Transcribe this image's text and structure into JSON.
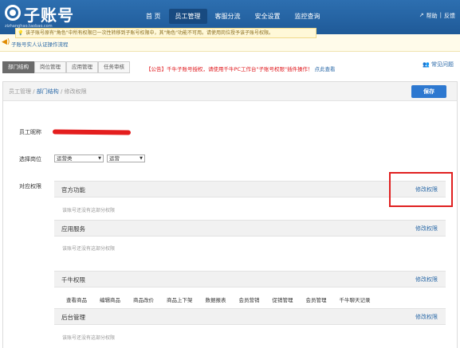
{
  "header": {
    "logo_text": "子账号",
    "logo_sub": "zizhanghao.taobao.com",
    "nav": [
      "首 页",
      "员工管理",
      "客服分流",
      "安全设置",
      "监控查询"
    ],
    "active_nav": "员工管理",
    "help": "帮助",
    "feedback": "反馈"
  },
  "notice": {
    "text": "子账号实人认证操作流程"
  },
  "tabs": [
    "部门结构",
    "岗位管理",
    "应用管理",
    "任务审核"
  ],
  "announcement": {
    "text": "【公告】千牛子账号授权，请使用千牛PC工作台\"子账号权限\"插件操作！",
    "link": "点此查看"
  },
  "faq": "常见问题",
  "breadcrumb": {
    "root": "员工管理",
    "mid": "部门结构",
    "current": "修改权限",
    "sep": " / "
  },
  "save_label": "保存",
  "tip": "该子账号原有\"角色\"中所有权限已一次性转移到子账号权限中，其\"角色\"功能不可用。请使用岗位授予该子账号权限。",
  "form": {
    "nickname_label": "员工昵称",
    "position_label": "选择岗位",
    "position_select_1": "运营类",
    "position_select_2": "运营",
    "permission_label": "对应权限"
  },
  "permissions": [
    {
      "name": "官方功能",
      "edit": "修改权限",
      "note": "该账号还没有这部分权限"
    },
    {
      "name": "应用服务",
      "edit": "修改权限",
      "note": "该账号还没有这部分权限"
    },
    {
      "name": "千牛权限",
      "edit": "修改权限",
      "items": [
        "查看商品",
        "编辑商品",
        "商品改价",
        "商品上下架",
        "数据报表",
        "会员营销",
        "促销管理",
        "会员管理",
        "千牛聊天记录"
      ]
    },
    {
      "name": "后台管理",
      "edit": "修改权限",
      "note": "该账号还没有这部分权限"
    }
  ]
}
